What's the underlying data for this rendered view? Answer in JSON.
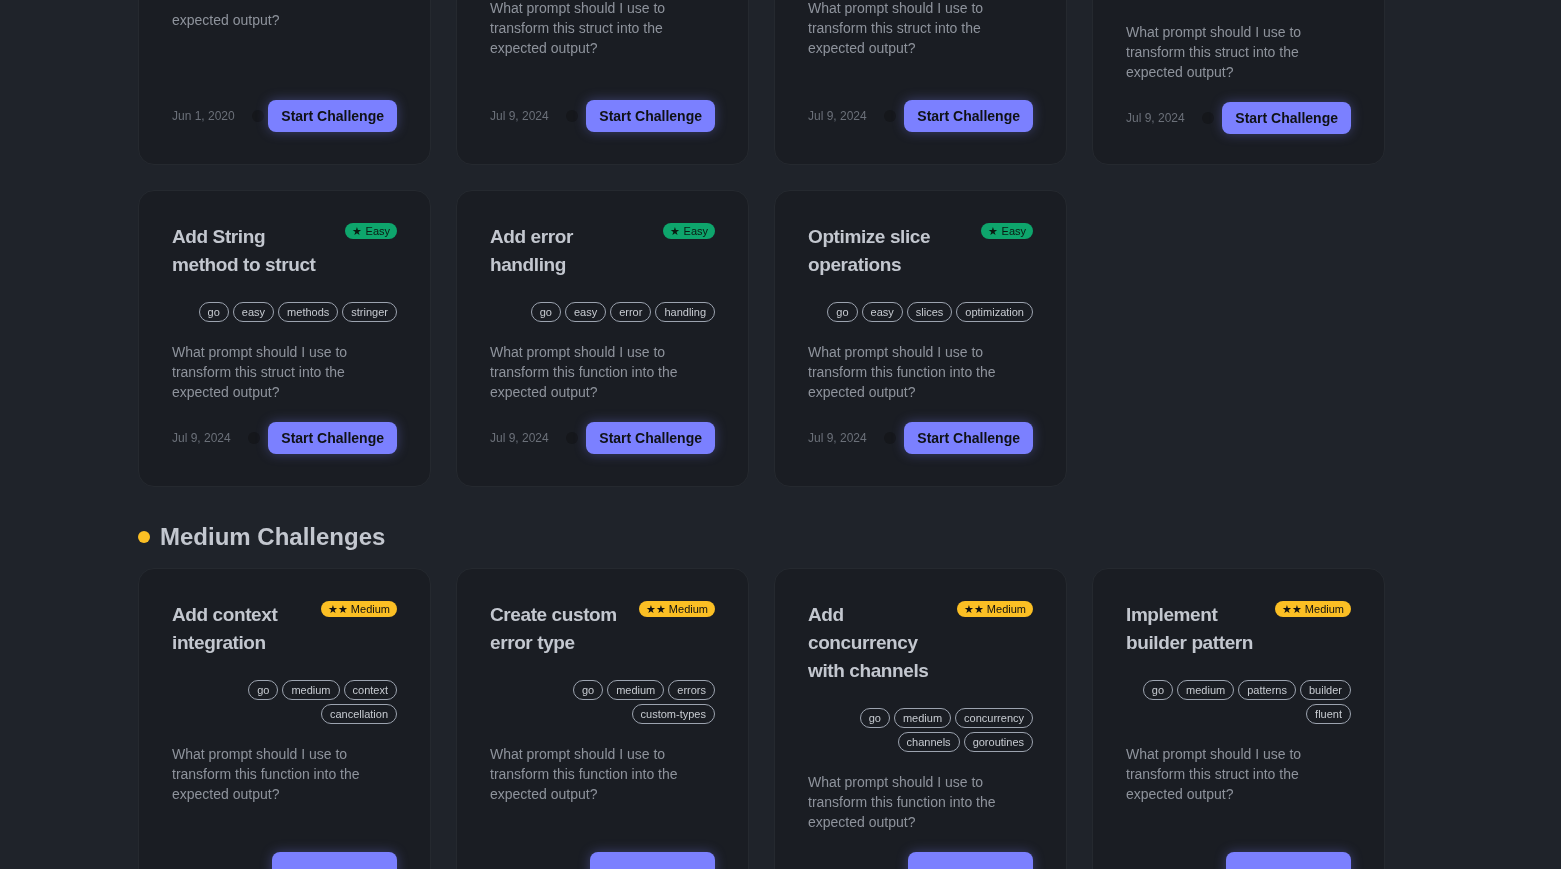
{
  "top_cards": [
    {
      "description": "expected output?",
      "date": "Jun 1, 2020",
      "button": "Start Challenge"
    },
    {
      "description": "What prompt should I use to transform this struct into the expected output?",
      "date": "Jul 9, 2024",
      "button": "Start Challenge"
    },
    {
      "description": "What prompt should I use to transform this struct into the expected output?",
      "date": "Jul 9, 2024",
      "button": "Start Challenge"
    },
    {
      "description": "What prompt should I use to transform this struct into the expected output?",
      "date": "Jul 9, 2024",
      "button": "Start Challenge"
    }
  ],
  "easy_cards": [
    {
      "title": "Add String method to struct",
      "badge": {
        "kind": "easy",
        "label": "★ Easy"
      },
      "tags": [
        "go",
        "easy",
        "methods",
        "stringer"
      ],
      "description": "What prompt should I use to transform this struct into the expected output?",
      "date": "Jul 9, 2024",
      "button": "Start Challenge"
    },
    {
      "title": "Add error handling",
      "badge": {
        "kind": "easy",
        "label": "★ Easy"
      },
      "tags": [
        "go",
        "easy",
        "error",
        "handling"
      ],
      "description": "What prompt should I use to transform this function into the expected output?",
      "date": "Jul 9, 2024",
      "button": "Start Challenge"
    },
    {
      "title": "Optimize slice operations",
      "badge": {
        "kind": "easy",
        "label": "★ Easy"
      },
      "tags": [
        "go",
        "easy",
        "slices",
        "optimization"
      ],
      "description": "What prompt should I use to transform this function into the expected output?",
      "date": "Jul 9, 2024",
      "button": "Start Challenge"
    }
  ],
  "medium_section": {
    "title": "Medium Challenges",
    "cards": [
      {
        "title": "Add context integration",
        "badge": {
          "kind": "medium",
          "label": "★★ Medium"
        },
        "tags": [
          "go",
          "medium",
          "context",
          "cancellation"
        ],
        "description": "What prompt should I use to transform this function into the expected output?"
      },
      {
        "title": "Create custom error type",
        "badge": {
          "kind": "medium",
          "label": "★★ Medium"
        },
        "tags": [
          "go",
          "medium",
          "errors",
          "custom-types"
        ],
        "description": "What prompt should I use to transform this function into the expected output?"
      },
      {
        "title": "Add concurrency with channels",
        "badge": {
          "kind": "medium",
          "label": "★★ Medium"
        },
        "tags": [
          "go",
          "medium",
          "concurrency",
          "channels",
          "goroutines"
        ],
        "description": "What prompt should I use to transform this function into the expected output?"
      },
      {
        "title": "Implement builder pattern",
        "badge": {
          "kind": "medium",
          "label": "★★ Medium"
        },
        "tags": [
          "go",
          "medium",
          "patterns",
          "builder",
          "fluent"
        ],
        "description": "What prompt should I use to transform this struct into the expected output?"
      }
    ]
  }
}
